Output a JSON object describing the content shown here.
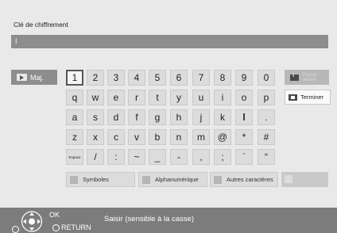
{
  "title": "Clé de chiffrement",
  "input": {
    "value": "I"
  },
  "maj_label": "Maj.",
  "retour_label": "Retour arrière",
  "terminer_label": "Terminer",
  "keys": {
    "row1": [
      "1",
      "2",
      "3",
      "4",
      "5",
      "6",
      "7",
      "8",
      "9",
      "0"
    ],
    "row2": [
      "q",
      "w",
      "e",
      "r",
      "t",
      "y",
      "u",
      "i",
      "o",
      "p"
    ],
    "row3": [
      "a",
      "s",
      "d",
      "f",
      "g",
      "h",
      "j",
      "k",
      "l",
      "."
    ],
    "row4": [
      "z",
      "x",
      "c",
      "v",
      "b",
      "n",
      "m",
      "@",
      "*",
      "#"
    ],
    "row5": [
      "Espace",
      "/",
      ":",
      "~",
      "_",
      "-",
      ",",
      ";",
      "`",
      "“"
    ]
  },
  "modes": [
    "Symboles",
    "Alphanumérique",
    "Autres caractères"
  ],
  "footer": {
    "ok": "OK",
    "return": "RETURN",
    "hint": "Saisir (sensible à la casse)"
  },
  "colors": {
    "background": "#e9e9e9",
    "input_bar": "#8d8d8d",
    "footer": "#7c7c7c",
    "key": "#dcdcdc"
  }
}
